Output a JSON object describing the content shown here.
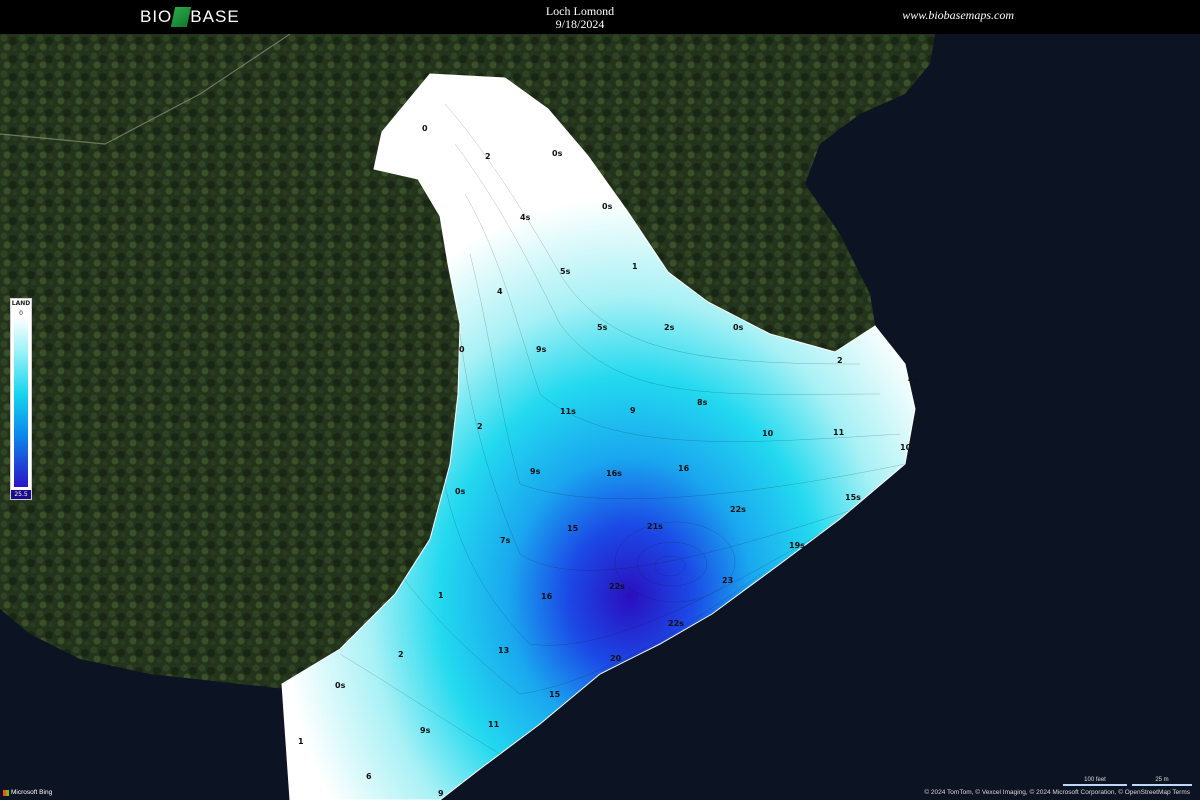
{
  "header": {
    "logo_left": "BIO",
    "logo_right": "BASE",
    "title": "Loch Lomond",
    "date": "9/18/2024",
    "website": "www.biobasemaps.com"
  },
  "legend": {
    "header": "LAND",
    "min": "0",
    "max": "25.5"
  },
  "colors": {
    "land": "#1f2d18",
    "water": "#0c1322",
    "depth_shallow": "#ffffff",
    "depth_mid": "#17d6ee",
    "depth_deep": "#2a15c8"
  },
  "contour_labels": [
    "0",
    "2",
    "0s",
    "0s",
    "1",
    "4s",
    "5s",
    "4",
    "9s",
    "5s",
    "2s",
    "0s",
    "0",
    "2",
    "11s",
    "9",
    "8s",
    "10",
    "11",
    "4s",
    "10",
    "2",
    "9s",
    "16s",
    "16",
    "0s",
    "7s",
    "15",
    "21s",
    "22s",
    "15s",
    "19s",
    "23",
    "22s",
    "16",
    "1",
    "22s",
    "13",
    "20",
    "2",
    "0s",
    "15",
    "11",
    "9s",
    "1",
    "6",
    "9"
  ],
  "scale": {
    "left_label": "100 feet",
    "right_label": "25 m"
  },
  "attribution": "© 2024 TomTom, © Vexcel Imaging, © 2024 Microsoft Corporation, © OpenStreetMap  Terms",
  "bing_label": "Microsoft Bing"
}
